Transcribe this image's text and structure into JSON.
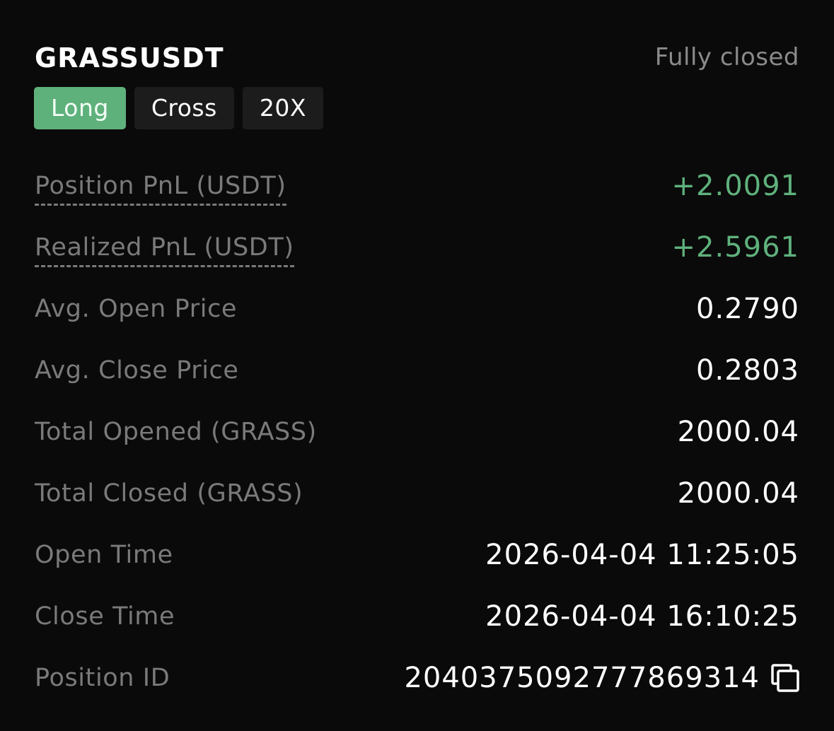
{
  "position": {
    "symbol": "GRASSUSDT",
    "status": "Fully closed",
    "tags": {
      "side": "Long",
      "margin_mode": "Cross",
      "leverage": "20X"
    },
    "colors": {
      "positive": "#5fb17c",
      "label": "#7a7a7a",
      "background": "#0a0a0a"
    },
    "details": {
      "position_pnl_label": "Position PnL (USDT)",
      "position_pnl_value": "+2.0091",
      "realized_pnl_label": "Realized PnL (USDT)",
      "realized_pnl_value": "+2.5961",
      "avg_open_price_label": "Avg. Open Price",
      "avg_open_price_value": "0.2790",
      "avg_close_price_label": "Avg. Close Price",
      "avg_close_price_value": "0.2803",
      "total_opened_label": "Total Opened (GRASS)",
      "total_opened_value": "2000.04",
      "total_closed_label": "Total Closed (GRASS)",
      "total_closed_value": "2000.04",
      "open_time_label": "Open Time",
      "open_time_value": "2026-04-04 11:25:05",
      "close_time_label": "Close Time",
      "close_time_value": "2026-04-04 16:10:25",
      "position_id_label": "Position ID",
      "position_id_value": "2040375092777869314",
      "copy_icon": "copy-icon"
    }
  }
}
